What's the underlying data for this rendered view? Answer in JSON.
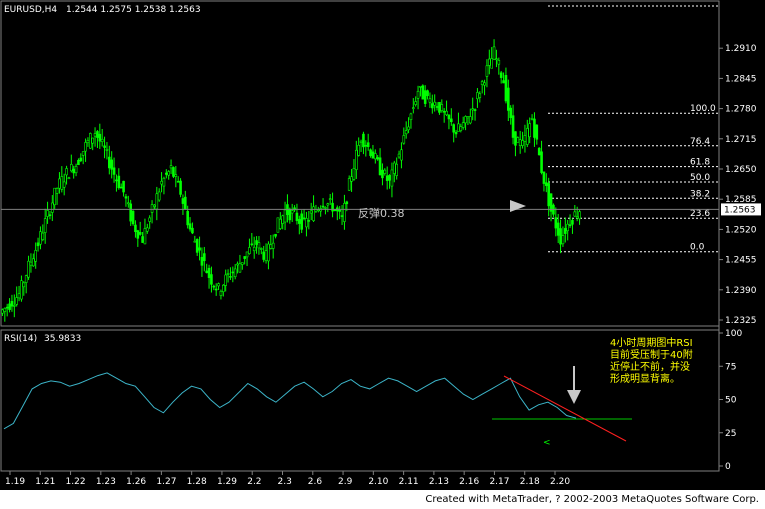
{
  "header": {
    "symbol": "EURUSD,H4",
    "ohlc": "1.2544 1.2575 1.2538 1.2563"
  },
  "rsi_header": {
    "label": "RSI(14)",
    "value": "35.9833"
  },
  "annotation": {
    "rebound_label": "反弹0.38",
    "note_lines": [
      "4小时周期图中RSI",
      "目前受压制于40附",
      "近停止不前，并没",
      "形成明显背离。"
    ],
    "small_mark": "<"
  },
  "current_price_tag": "1.2563",
  "footer": "Created with MetaTrader, ? 2002-2003 MetaQuotes Software Corp.",
  "colors": {
    "background": "#000000",
    "candles": "#00ff00",
    "rsi_line": "#3cb4c8",
    "trendline": "#ff2020",
    "support_line": "#00c800",
    "fib_lines": "#ffffff",
    "note_text": "#ffff00",
    "arrow": "#c8c8c8"
  },
  "chart_data": [
    {
      "type": "candlestick",
      "symbol": "EURUSD,H4",
      "ylim": [
        1.2325,
        1.2975
      ],
      "y_ticks": [
        "1.2910",
        "1.2845",
        "1.2780",
        "1.2715",
        "1.2650",
        "1.2585",
        "1.2520",
        "1.2455",
        "1.2390",
        "1.2325"
      ],
      "x_ticks": [
        "1.19",
        "1.21",
        "1.22",
        "1.23",
        "1.26",
        "1.27",
        "1.28",
        "1.29",
        "2.2",
        "2.3",
        "2.6",
        "2.9",
        "2.10",
        "2.11",
        "2.13",
        "2.16",
        "2.17",
        "2.18",
        "2.20"
      ],
      "close_path_approx": [
        1.236,
        1.238,
        1.244,
        1.249,
        1.255,
        1.261,
        1.264,
        1.266,
        1.27,
        1.273,
        1.269,
        1.264,
        1.26,
        1.253,
        1.25,
        1.256,
        1.262,
        1.265,
        1.26,
        1.252,
        1.247,
        1.242,
        1.239,
        1.242,
        1.244,
        1.247,
        1.249,
        1.246,
        1.252,
        1.256,
        1.255,
        1.253,
        1.256,
        1.258,
        1.257,
        1.254,
        1.264,
        1.272,
        1.269,
        1.265,
        1.262,
        1.268,
        1.275,
        1.282,
        1.28,
        1.279,
        1.276,
        1.273,
        1.275,
        1.279,
        1.285,
        1.29,
        1.284,
        1.272,
        1.27,
        1.276,
        1.265,
        1.256,
        1.25,
        1.254,
        1.2563
      ],
      "fibonacci": [
        {
          "level": "100.0",
          "price": 1.277
        },
        {
          "level": "76.4",
          "price": 1.27
        },
        {
          "level": "61.8",
          "price": 1.2655
        },
        {
          "level": "50.0",
          "price": 1.2622
        },
        {
          "level": "38.2",
          "price": 1.2587
        },
        {
          "level": "23.6",
          "price": 1.2544
        },
        {
          "level": "0.0",
          "price": 1.2472
        }
      ],
      "current_price": 1.2563
    },
    {
      "type": "line",
      "name": "RSI(14)",
      "ylim": [
        0,
        100
      ],
      "y_ticks": [
        "100",
        "75",
        "50",
        "25",
        "0"
      ],
      "values_approx": [
        28,
        32,
        45,
        58,
        62,
        64,
        63,
        60,
        62,
        65,
        68,
        70,
        66,
        62,
        60,
        52,
        44,
        40,
        48,
        55,
        60,
        58,
        50,
        44,
        48,
        55,
        62,
        58,
        52,
        48,
        54,
        60,
        63,
        58,
        52,
        56,
        62,
        65,
        60,
        58,
        62,
        66,
        64,
        60,
        56,
        60,
        64,
        66,
        60,
        54,
        50,
        54,
        58,
        62,
        66,
        52,
        42,
        46,
        48,
        44,
        38,
        36
      ],
      "support_level": 40,
      "current_value": 35.9833
    }
  ]
}
